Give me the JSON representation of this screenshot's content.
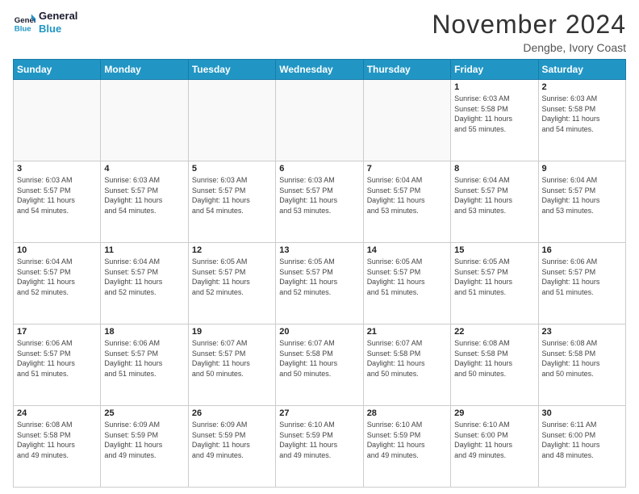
{
  "logo": {
    "line1": "General",
    "line2": "Blue"
  },
  "title": "November 2024",
  "location": "Dengbe, Ivory Coast",
  "weekdays": [
    "Sunday",
    "Monday",
    "Tuesday",
    "Wednesday",
    "Thursday",
    "Friday",
    "Saturday"
  ],
  "weeks": [
    [
      {
        "day": "",
        "info": ""
      },
      {
        "day": "",
        "info": ""
      },
      {
        "day": "",
        "info": ""
      },
      {
        "day": "",
        "info": ""
      },
      {
        "day": "",
        "info": ""
      },
      {
        "day": "1",
        "info": "Sunrise: 6:03 AM\nSunset: 5:58 PM\nDaylight: 11 hours\nand 55 minutes."
      },
      {
        "day": "2",
        "info": "Sunrise: 6:03 AM\nSunset: 5:58 PM\nDaylight: 11 hours\nand 54 minutes."
      }
    ],
    [
      {
        "day": "3",
        "info": "Sunrise: 6:03 AM\nSunset: 5:57 PM\nDaylight: 11 hours\nand 54 minutes."
      },
      {
        "day": "4",
        "info": "Sunrise: 6:03 AM\nSunset: 5:57 PM\nDaylight: 11 hours\nand 54 minutes."
      },
      {
        "day": "5",
        "info": "Sunrise: 6:03 AM\nSunset: 5:57 PM\nDaylight: 11 hours\nand 54 minutes."
      },
      {
        "day": "6",
        "info": "Sunrise: 6:03 AM\nSunset: 5:57 PM\nDaylight: 11 hours\nand 53 minutes."
      },
      {
        "day": "7",
        "info": "Sunrise: 6:04 AM\nSunset: 5:57 PM\nDaylight: 11 hours\nand 53 minutes."
      },
      {
        "day": "8",
        "info": "Sunrise: 6:04 AM\nSunset: 5:57 PM\nDaylight: 11 hours\nand 53 minutes."
      },
      {
        "day": "9",
        "info": "Sunrise: 6:04 AM\nSunset: 5:57 PM\nDaylight: 11 hours\nand 53 minutes."
      }
    ],
    [
      {
        "day": "10",
        "info": "Sunrise: 6:04 AM\nSunset: 5:57 PM\nDaylight: 11 hours\nand 52 minutes."
      },
      {
        "day": "11",
        "info": "Sunrise: 6:04 AM\nSunset: 5:57 PM\nDaylight: 11 hours\nand 52 minutes."
      },
      {
        "day": "12",
        "info": "Sunrise: 6:05 AM\nSunset: 5:57 PM\nDaylight: 11 hours\nand 52 minutes."
      },
      {
        "day": "13",
        "info": "Sunrise: 6:05 AM\nSunset: 5:57 PM\nDaylight: 11 hours\nand 52 minutes."
      },
      {
        "day": "14",
        "info": "Sunrise: 6:05 AM\nSunset: 5:57 PM\nDaylight: 11 hours\nand 51 minutes."
      },
      {
        "day": "15",
        "info": "Sunrise: 6:05 AM\nSunset: 5:57 PM\nDaylight: 11 hours\nand 51 minutes."
      },
      {
        "day": "16",
        "info": "Sunrise: 6:06 AM\nSunset: 5:57 PM\nDaylight: 11 hours\nand 51 minutes."
      }
    ],
    [
      {
        "day": "17",
        "info": "Sunrise: 6:06 AM\nSunset: 5:57 PM\nDaylight: 11 hours\nand 51 minutes."
      },
      {
        "day": "18",
        "info": "Sunrise: 6:06 AM\nSunset: 5:57 PM\nDaylight: 11 hours\nand 51 minutes."
      },
      {
        "day": "19",
        "info": "Sunrise: 6:07 AM\nSunset: 5:57 PM\nDaylight: 11 hours\nand 50 minutes."
      },
      {
        "day": "20",
        "info": "Sunrise: 6:07 AM\nSunset: 5:58 PM\nDaylight: 11 hours\nand 50 minutes."
      },
      {
        "day": "21",
        "info": "Sunrise: 6:07 AM\nSunset: 5:58 PM\nDaylight: 11 hours\nand 50 minutes."
      },
      {
        "day": "22",
        "info": "Sunrise: 6:08 AM\nSunset: 5:58 PM\nDaylight: 11 hours\nand 50 minutes."
      },
      {
        "day": "23",
        "info": "Sunrise: 6:08 AM\nSunset: 5:58 PM\nDaylight: 11 hours\nand 50 minutes."
      }
    ],
    [
      {
        "day": "24",
        "info": "Sunrise: 6:08 AM\nSunset: 5:58 PM\nDaylight: 11 hours\nand 49 minutes."
      },
      {
        "day": "25",
        "info": "Sunrise: 6:09 AM\nSunset: 5:59 PM\nDaylight: 11 hours\nand 49 minutes."
      },
      {
        "day": "26",
        "info": "Sunrise: 6:09 AM\nSunset: 5:59 PM\nDaylight: 11 hours\nand 49 minutes."
      },
      {
        "day": "27",
        "info": "Sunrise: 6:10 AM\nSunset: 5:59 PM\nDaylight: 11 hours\nand 49 minutes."
      },
      {
        "day": "28",
        "info": "Sunrise: 6:10 AM\nSunset: 5:59 PM\nDaylight: 11 hours\nand 49 minutes."
      },
      {
        "day": "29",
        "info": "Sunrise: 6:10 AM\nSunset: 6:00 PM\nDaylight: 11 hours\nand 49 minutes."
      },
      {
        "day": "30",
        "info": "Sunrise: 6:11 AM\nSunset: 6:00 PM\nDaylight: 11 hours\nand 48 minutes."
      }
    ]
  ]
}
